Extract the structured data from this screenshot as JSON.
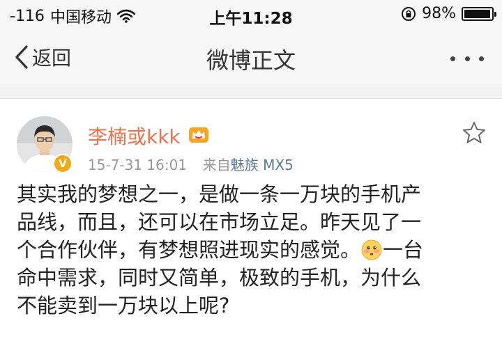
{
  "status_bar": {
    "signal": "-116",
    "carrier": "中国移动",
    "time": "上午11:28",
    "battery_percent": "98%",
    "battery_level": 0.98,
    "icons": [
      "wifi-icon",
      "rotation-lock-icon",
      "battery-icon"
    ]
  },
  "nav": {
    "back_label": "返回",
    "title": "微博正文"
  },
  "post": {
    "author": "李楠或kkk",
    "timestamp": "15-7-31 16:01",
    "source_prefix": "来自",
    "source_device": "魅族 MX5",
    "text_lines": [
      "其实我的梦想之一，是做一条一万块的手机产",
      "品线，而且，还可以在市场立足。昨天见了一",
      "个合作伙伴，有梦想照进现实的感觉。",
      "一台",
      "命中需求，同时又简单，极致的手机，为什么",
      "不能卖到一万块以上呢?"
    ],
    "colors": {
      "author": "#eb7350",
      "meta": "#999999",
      "source": "#5d7895",
      "verified": "#f3a915"
    }
  }
}
